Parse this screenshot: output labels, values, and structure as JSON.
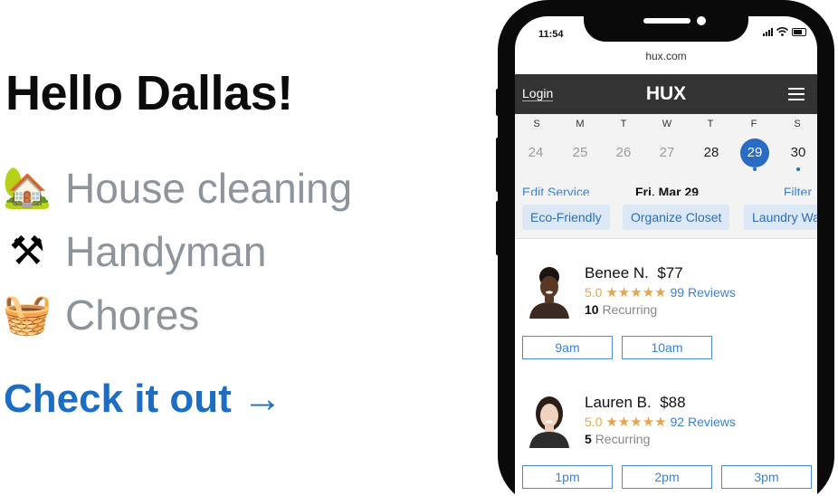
{
  "promo": {
    "title": "Hello Dallas!",
    "services": [
      {
        "emoji": "🏡",
        "label": "House cleaning"
      },
      {
        "emoji": "⚒",
        "label": "Handyman"
      },
      {
        "emoji": "🧺",
        "label": "Chores"
      }
    ],
    "cta": "Check it out →"
  },
  "phone": {
    "status_time": "11:54",
    "url": "hux.com",
    "nav": {
      "login": "Login",
      "logo": "HUX"
    },
    "calendar": {
      "weekdays": [
        "S",
        "M",
        "T",
        "W",
        "T",
        "F",
        "S"
      ],
      "dates": [
        "24",
        "25",
        "26",
        "27",
        "28",
        "29",
        "30"
      ],
      "selected": "29",
      "edit_service": "Edit Service",
      "current_date": "Fri. Mar 29",
      "filter": "Filter"
    },
    "chips": [
      "Eco-Friendly",
      "Organize Closet",
      "Laundry Wa"
    ],
    "providers": [
      {
        "name": "Benee N.",
        "price": "$77",
        "rating": "5.0",
        "stars": "★★★★★",
        "reviews": "99 Reviews",
        "recurring_count": "10",
        "recurring_label": "Recurring",
        "slots": [
          "9am",
          "10am"
        ]
      },
      {
        "name": "Lauren B.",
        "price": "$88",
        "rating": "5.0",
        "stars": "★★★★★",
        "reviews": "92 Reviews",
        "recurring_count": "5",
        "recurring_label": "Recurring",
        "slots": [
          "1pm",
          "2pm",
          "3pm"
        ]
      }
    ]
  },
  "colors": {
    "accent": "#2a6bc4",
    "link": "#3a82d6",
    "star": "#e8a44c",
    "navbar": "#333333",
    "service_text": "#8d949c"
  },
  "icons": [
    "house-icon",
    "tools-icon",
    "basket-icon",
    "signal-icon",
    "wifi-icon",
    "battery-icon",
    "hamburger-menu-icon",
    "avatar-icon"
  ]
}
